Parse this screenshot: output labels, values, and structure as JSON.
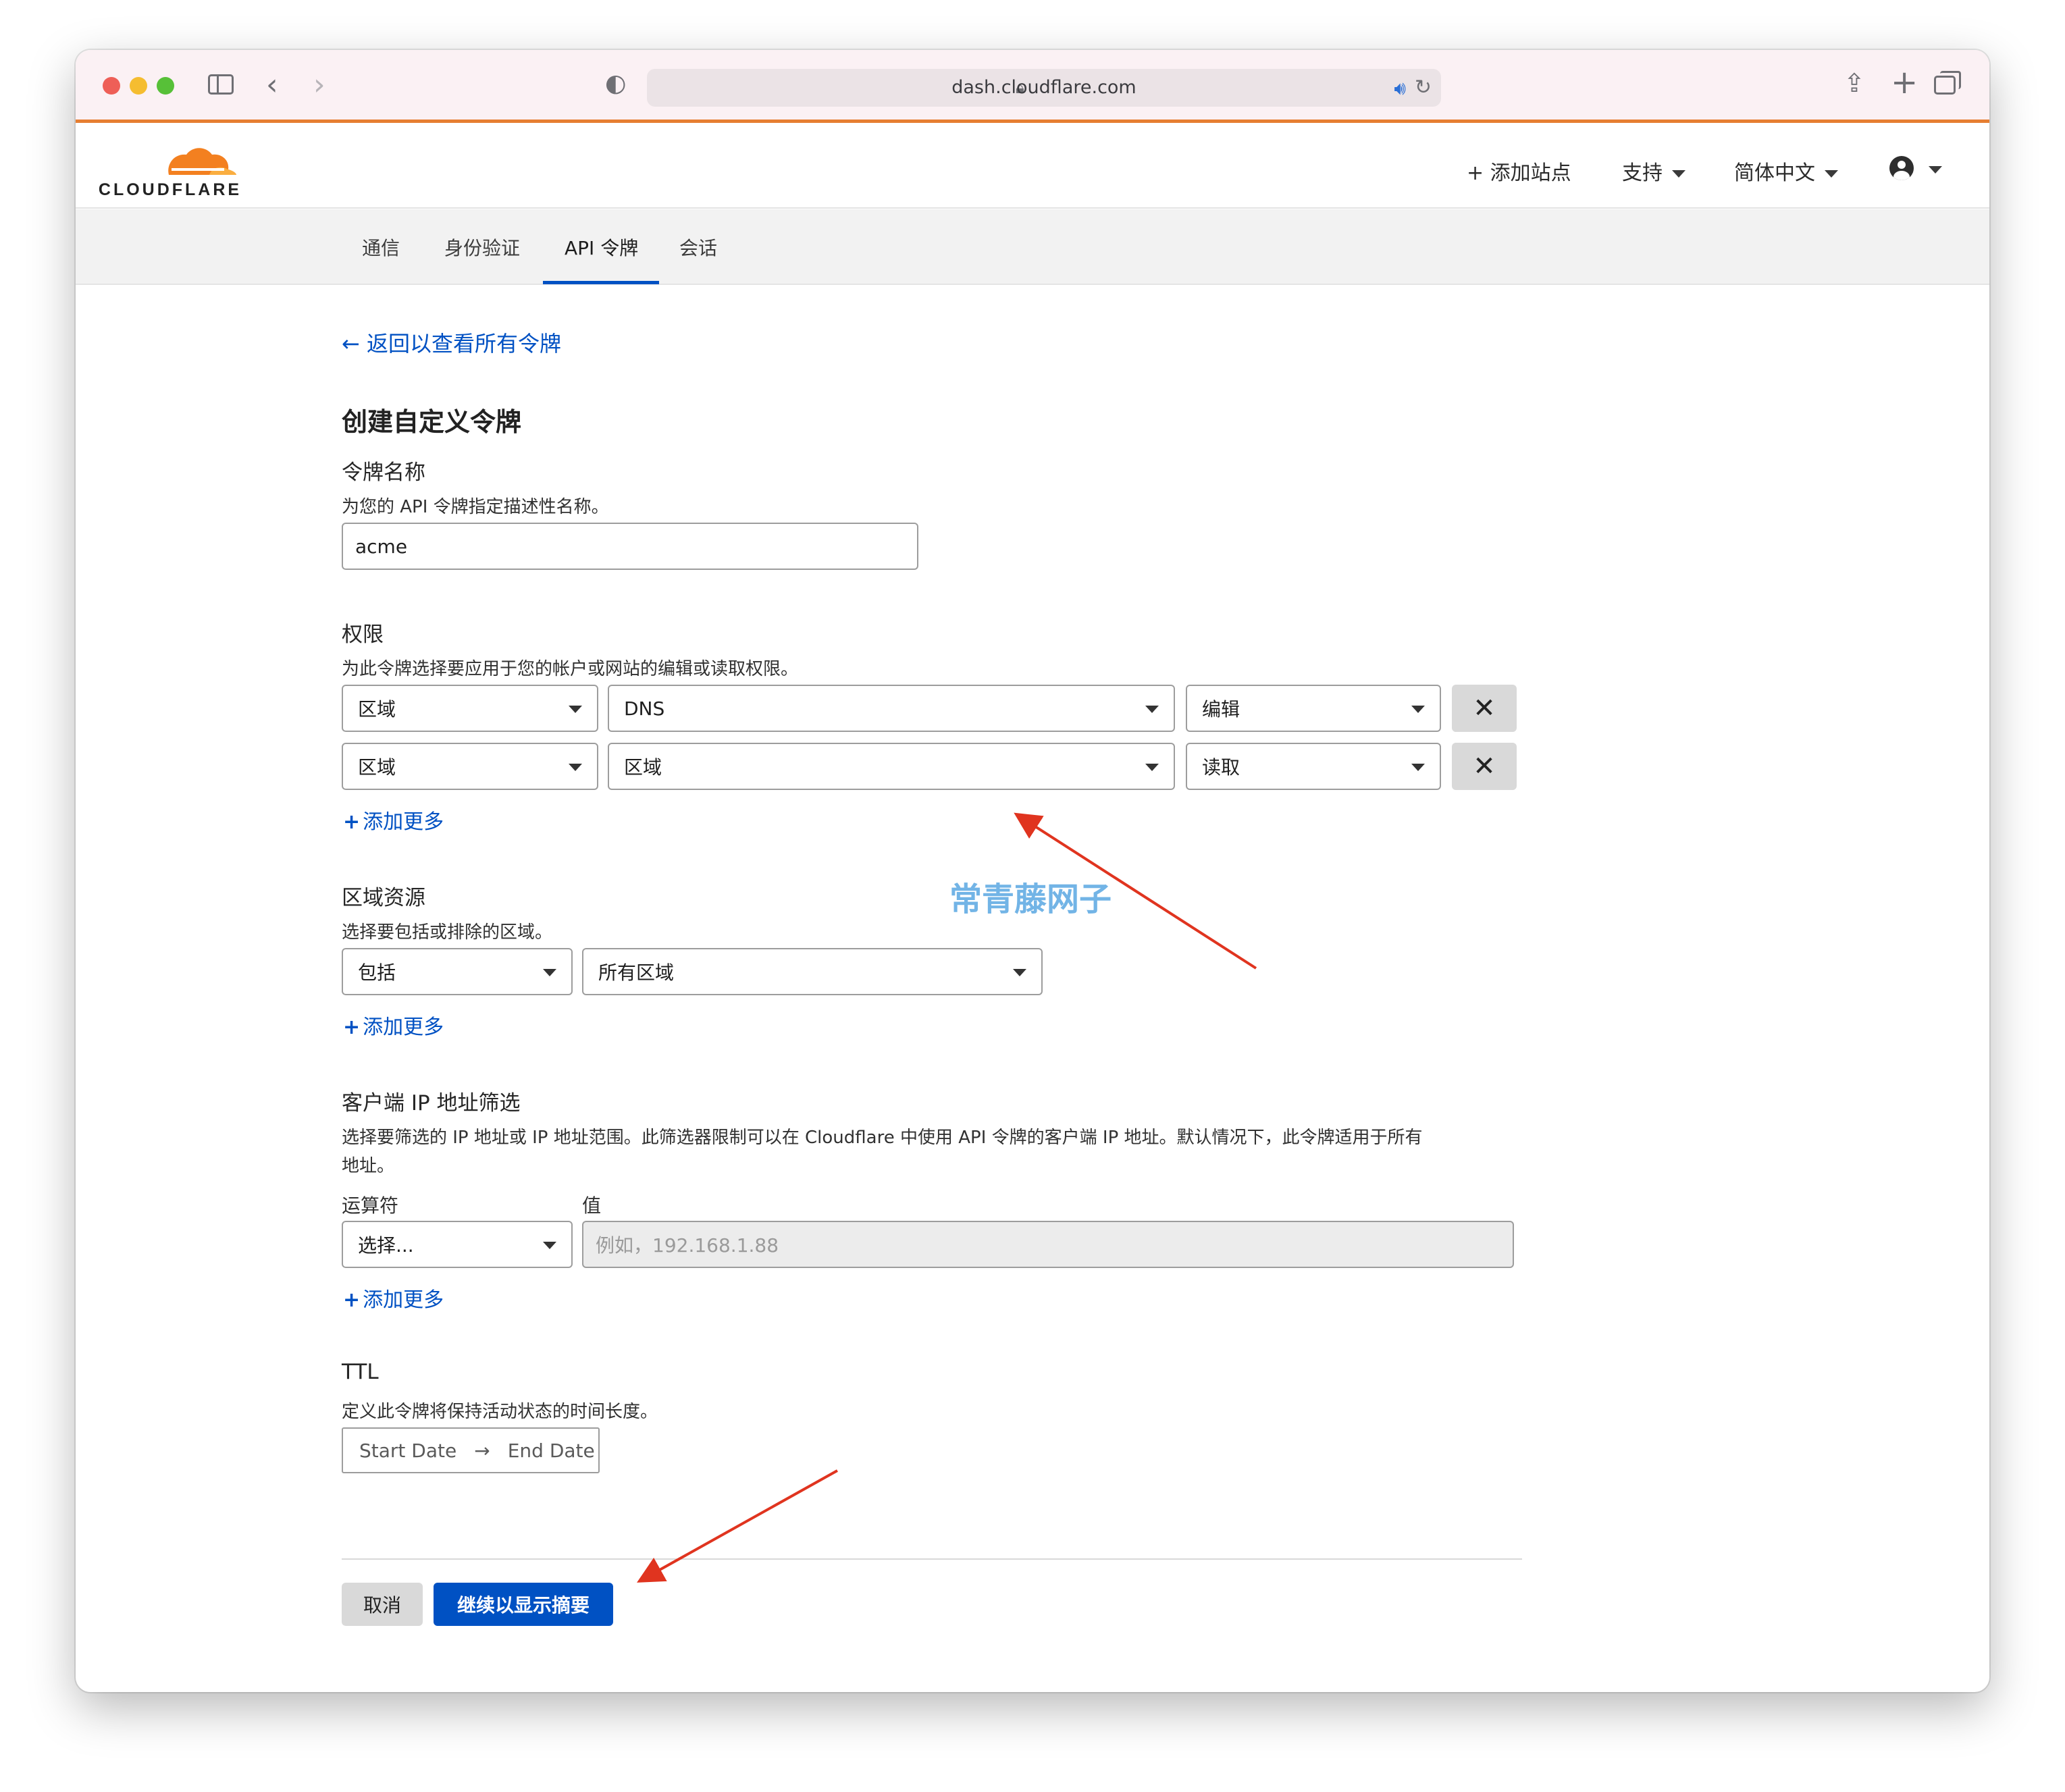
{
  "browser": {
    "url": "dash.cloudflare.com",
    "icons": [
      "sidebar-icon",
      "back-icon",
      "forward-icon",
      "shield-icon",
      "lock-icon",
      "sound-icon",
      "reload-icon",
      "share-icon",
      "new-tab-icon",
      "tab-overview-icon"
    ]
  },
  "header": {
    "logo_text": "CLOUDFLARE",
    "add_site": "+ 添加站点",
    "support": "支持",
    "language": "简体中文"
  },
  "subnav": {
    "tabs": [
      {
        "label": "通信"
      },
      {
        "label": "身份验证"
      },
      {
        "label": "API 令牌",
        "active": true
      },
      {
        "label": "会话"
      }
    ]
  },
  "form": {
    "back_link": "← 返回以查看所有令牌",
    "title": "创建自定义令牌",
    "token_name": {
      "label": "令牌名称",
      "description": "为您的 API 令牌指定描述性名称。",
      "value": "acme"
    },
    "permissions": {
      "label": "权限",
      "description": "为此令牌选择要应用于您的帐户或网站的编辑或读取权限。",
      "rows": [
        {
          "scope": "区域",
          "resource": "DNS",
          "access": "编辑"
        },
        {
          "scope": "区域",
          "resource": "区域",
          "access": "读取"
        }
      ],
      "remove_label": "✕",
      "add_more": "添加更多"
    },
    "zone_resources": {
      "label": "区域资源",
      "description": "选择要包括或排除的区域。",
      "include": "包括",
      "zones": "所有区域",
      "add_more": "添加更多"
    },
    "client_ip": {
      "label": "客户端 IP 地址筛选",
      "description_line1": "选择要筛选的 IP 地址或 IP 地址范围。此筛选器限制可以在 Cloudflare 中使用 API 令牌的客户端 IP 地址。默认情况下，此令牌适用于所有",
      "description_line2": "地址。",
      "operator_label": "运算符",
      "value_label": "值",
      "operator_value": "选择...",
      "value_placeholder": "例如，192.168.1.88",
      "add_more": "添加更多"
    },
    "ttl": {
      "label": "TTL",
      "description": "定义此令牌将保持活动状态的时间长度。",
      "start_date": "Start Date",
      "arrow": "→",
      "end_date": "End Date"
    },
    "buttons": {
      "cancel": "取消",
      "continue": "继续以显示摘要"
    }
  },
  "watermark": "常青藤网子",
  "colors": {
    "accent_blue": "#0051c3",
    "cloudflare_orange": "#f38020",
    "annotation_red": "#e0341f"
  }
}
